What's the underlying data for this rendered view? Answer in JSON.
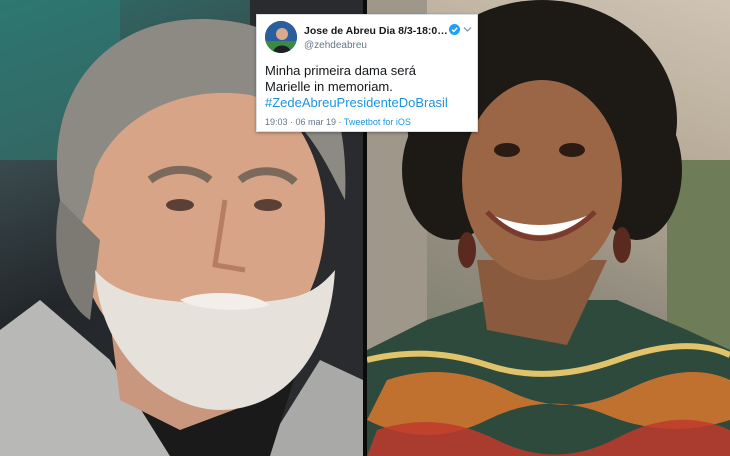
{
  "tweet": {
    "display_name": "Jose de Abreu Dia 8/3-18:00h-G...",
    "handle": "@zehdeabreu",
    "text_lines": [
      "Minha primeira dama será",
      "Marielle in memoriam."
    ],
    "hashtag": "#ZedeAbreuPresidenteDoBrasil",
    "timestamp": "19:03 · 06 mar 19 ·",
    "source": "Tweetbot for iOS",
    "icons": {
      "verified": "verified-badge-icon",
      "menu": "chevron-down-icon"
    },
    "colors": {
      "link": "#1b95e0",
      "verified": "#1da1f2",
      "muted": "#657786"
    }
  },
  "photos": {
    "left": "man-portrait-photo",
    "right": "woman-portrait-photo"
  }
}
